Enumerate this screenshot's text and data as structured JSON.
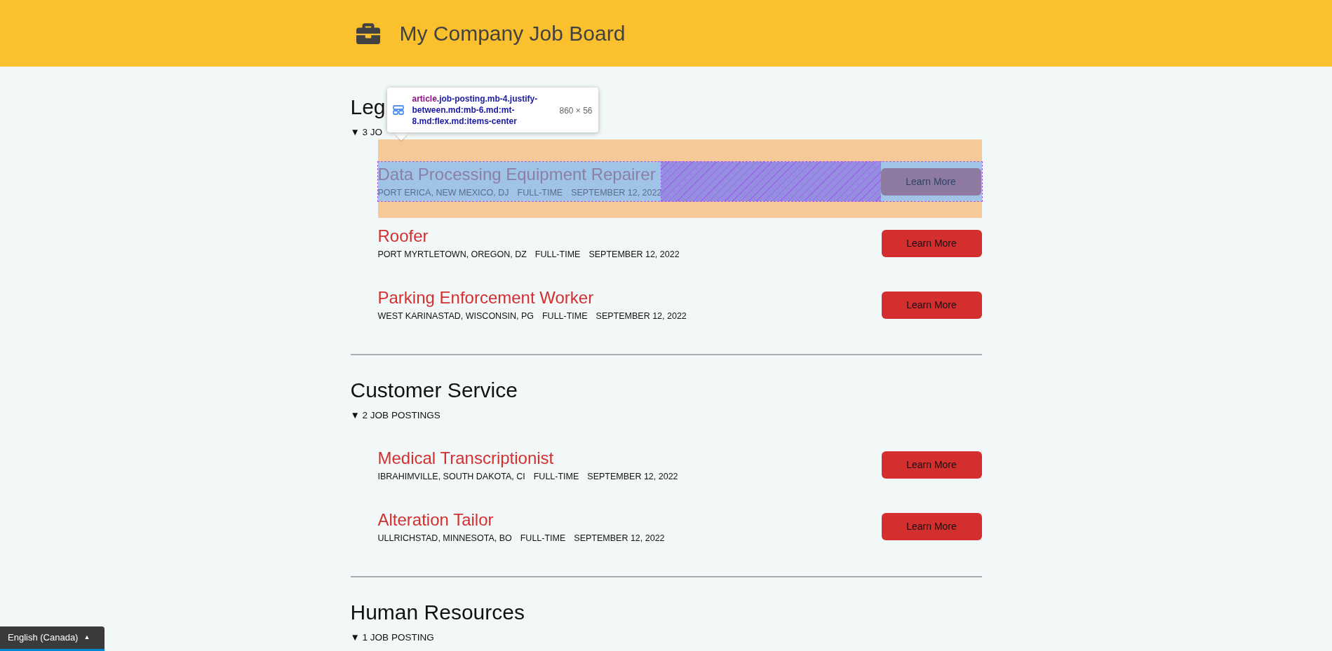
{
  "header": {
    "title": "My Company Job Board"
  },
  "inspector_tooltip": {
    "tag": "article",
    "classes": ".job-posting.mb-4.justify-between.md:mb-6.md:mt-8.md:flex.md:items-center",
    "size": "860 × 56"
  },
  "sections": [
    {
      "title": "Leg",
      "count": "▼ 3 JO",
      "jobs": [
        {
          "title": "Data Processing Equipment Repairer",
          "location": "PORT ERICA, NEW MEXICO, DJ",
          "type": "FULL-TIME",
          "date": "SEPTEMBER 12, 2022",
          "button": "Learn More",
          "highlighted": true
        },
        {
          "title": "Roofer",
          "location": "PORT MYRTLETOWN, OREGON, DZ",
          "type": "FULL-TIME",
          "date": "SEPTEMBER 12, 2022",
          "button": "Learn More",
          "highlighted": false
        },
        {
          "title": "Parking Enforcement Worker",
          "location": "WEST KARINASTAD, WISCONSIN, PG",
          "type": "FULL-TIME",
          "date": "SEPTEMBER 12, 2022",
          "button": "Learn More",
          "highlighted": false
        }
      ]
    },
    {
      "title": "Customer Service",
      "count": "▼ 2 JOB POSTINGS",
      "jobs": [
        {
          "title": "Medical Transcriptionist",
          "location": "IBRAHIMVILLE, SOUTH DAKOTA, CI",
          "type": "FULL-TIME",
          "date": "SEPTEMBER 12, 2022",
          "button": "Learn More",
          "highlighted": false
        },
        {
          "title": "Alteration Tailor",
          "location": "ULLRICHSTAD, MINNESOTA, BO",
          "type": "FULL-TIME",
          "date": "SEPTEMBER 12, 2022",
          "button": "Learn More",
          "highlighted": false
        }
      ]
    },
    {
      "title": "Human Resources",
      "count": "▼ 1 JOB POSTING"
    }
  ],
  "language_button": {
    "label": "English (Canada)",
    "caret": "▲"
  }
}
